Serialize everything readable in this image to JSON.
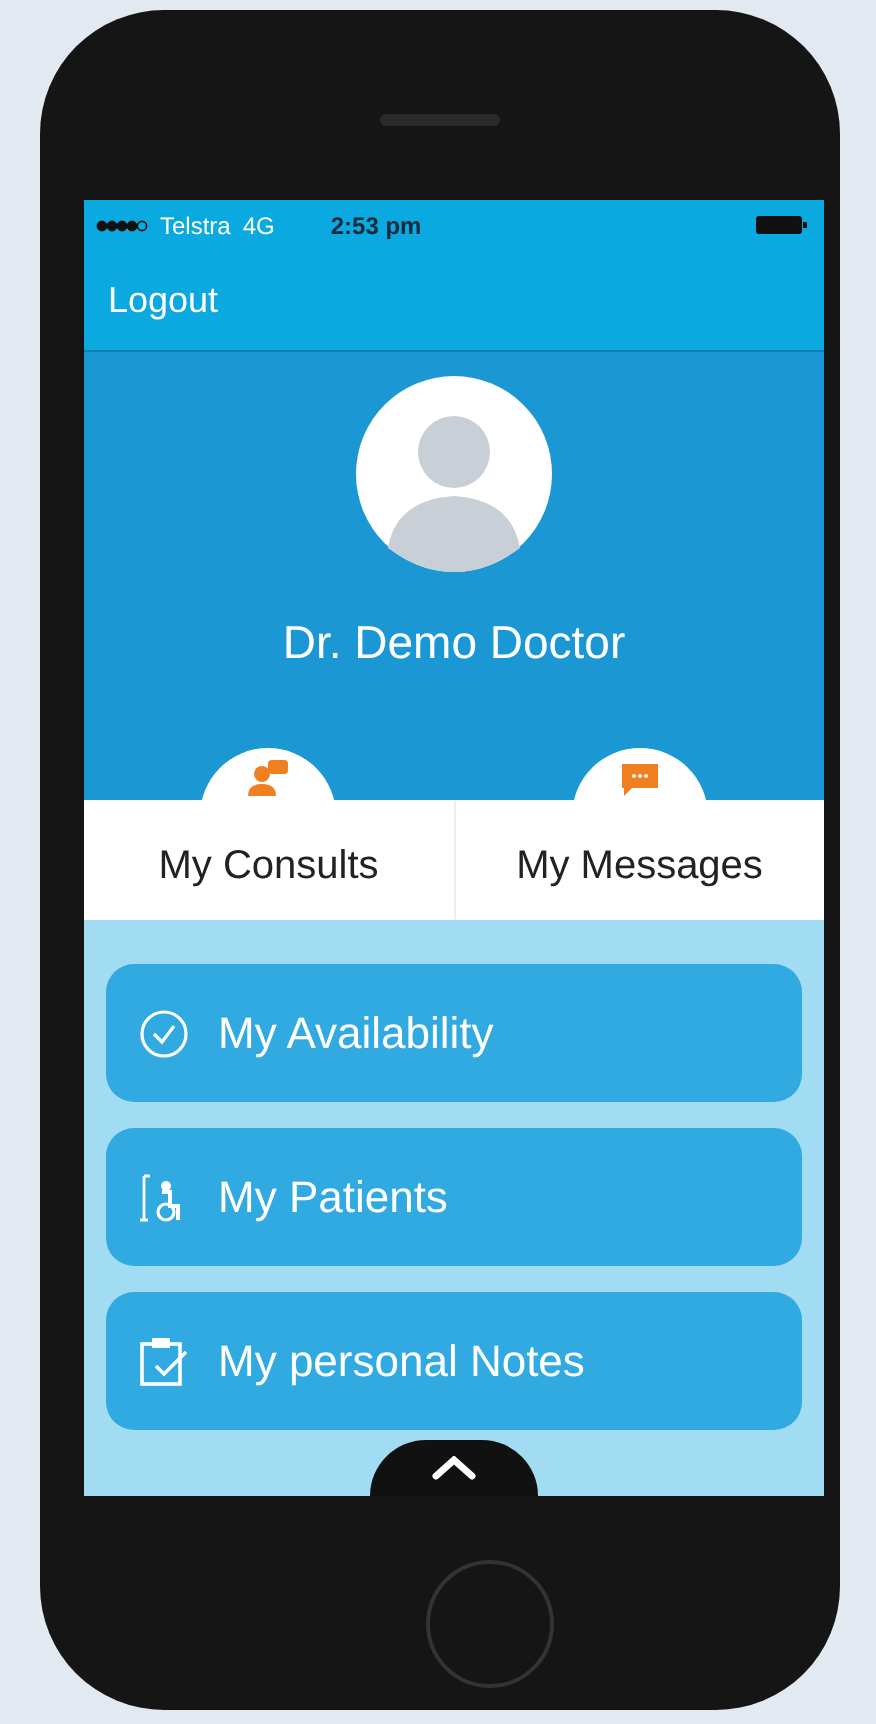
{
  "status_bar": {
    "carrier": "Telstra",
    "network": "4G",
    "time": "2:53 pm"
  },
  "nav_bar": {
    "button": "Logout"
  },
  "profile": {
    "name": "Dr. Demo Doctor"
  },
  "tabs": [
    {
      "label": "My Consults",
      "kind": "consults"
    },
    {
      "label": "My Messages",
      "kind": "messages"
    }
  ],
  "menu": [
    {
      "label": "My Availability",
      "kind": "clock"
    },
    {
      "label": "My Patients",
      "kind": "patient"
    },
    {
      "label": "My personal Notes",
      "kind": "notes"
    }
  ]
}
